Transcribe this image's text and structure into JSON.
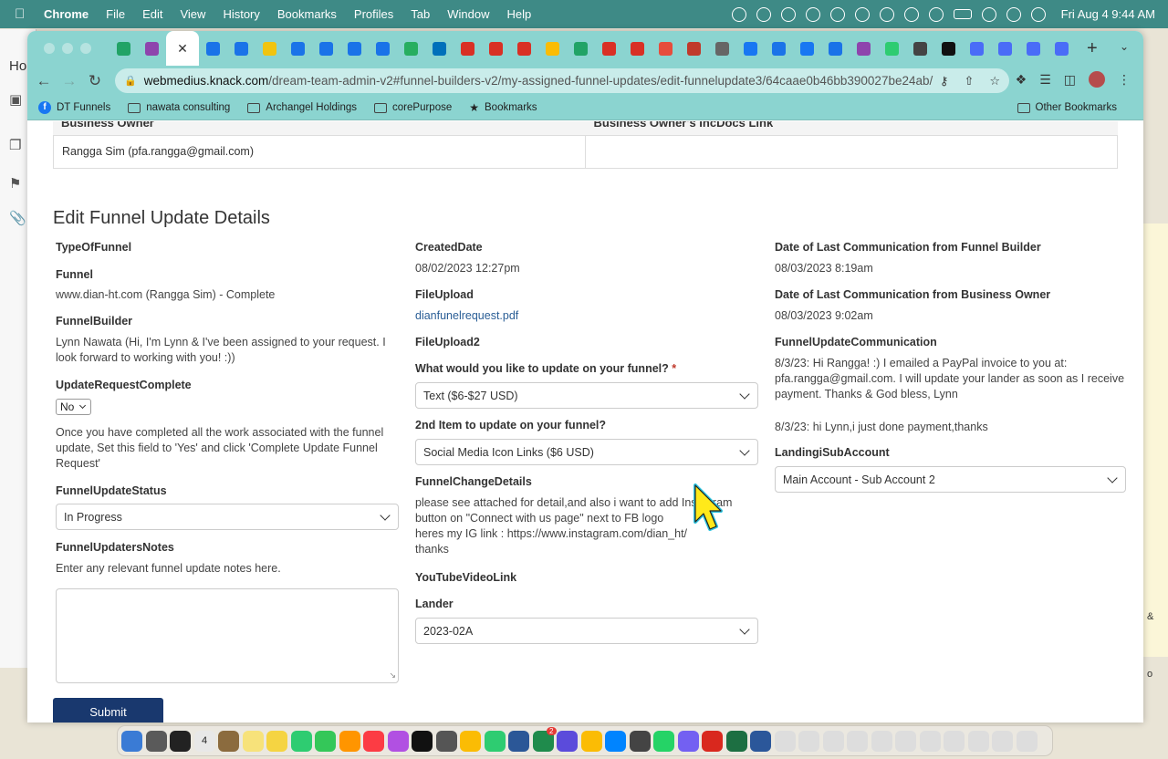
{
  "menubar": {
    "app_name": "Chrome",
    "items": [
      "File",
      "Edit",
      "View",
      "History",
      "Bookmarks",
      "Profiles",
      "Tab",
      "Window",
      "Help"
    ],
    "clock": "Fri Aug 4  9:44 AM"
  },
  "background": {
    "window_label": "Ho",
    "right_panel_texts": [
      "&",
      "o"
    ]
  },
  "browser": {
    "url_host": "webmedius.knack.com",
    "url_path": "/dream-team-admin-v2#funnel-builders-v2/my-assigned-funnel-updates/edit-funnelupdate3/64caae0b46bb390027be24ab/",
    "bookmarks": [
      "DT Funnels",
      "nawata consulting",
      "Archangel Holdings",
      "corePurpose",
      "Bookmarks"
    ],
    "other_bookmarks": "Other Bookmarks",
    "tab_favicon_colors": [
      "#21a366",
      "#8e44ad",
      "#1a73e8",
      "#1a73e8",
      "#f1c40f",
      "#1a73e8",
      "#1a73e8",
      "#1a73e8",
      "#1a73e8",
      "#27ae60",
      "#0070ba",
      "#d93025",
      "#d93025",
      "#d93025",
      "#fbbc04",
      "#21a366",
      "#d93025",
      "#d93025",
      "#e74c3c",
      "#c0392b",
      "#666666",
      "#1877f2",
      "#1a73e8",
      "#1877f2",
      "#1a73e8",
      "#8e44ad",
      "#2ecc71",
      "#444444",
      "#111111",
      "#4a6cf7",
      "#4a6cf7",
      "#4a6cf7",
      "#4a6cf7"
    ]
  },
  "owner_table": {
    "col1_header": "Business Owner",
    "col2_header": "Business Owner's IncDocs Link",
    "col1_value": "Rangga Sim (pfa.rangga@gmail.com)",
    "col2_value": ""
  },
  "form": {
    "title": "Edit Funnel Update Details",
    "col1": {
      "type_label": "TypeOfFunnel",
      "funnel_label": "Funnel",
      "funnel_value": "www.dian-ht.com (Rangga Sim) - Complete",
      "builder_label": "FunnelBuilder",
      "builder_value": "Lynn Nawata (Hi, I'm Lynn & I've been assigned to your request. I look forward to working with you! :))",
      "complete_label": "UpdateRequestComplete",
      "complete_value": "No",
      "complete_help": "Once you have completed all the work associated with the funnel update, Set this field to 'Yes' and click 'Complete Update Funnel Request'",
      "status_label": "FunnelUpdateStatus",
      "status_value": "In Progress",
      "notes_label": "FunnelUpdatersNotes",
      "notes_help": "Enter any relevant funnel update notes here."
    },
    "col2": {
      "created_label": "CreatedDate",
      "created_value": "08/02/2023 12:27pm",
      "fileupload_label": "FileUpload",
      "fileupload_value": "dianfunelrequest.pdf",
      "fileupload2_label": "FileUpload2",
      "update_label": "What would you like to update on your funnel?",
      "required_mark": "*",
      "update_value": "Text ($6-$27 USD)",
      "item2_label": "2nd Item to update on your funnel?",
      "item2_value": "Social Media Icon Links ($6 USD)",
      "details_label": "FunnelChangeDetails",
      "details_lines": [
        "please see attached for detail,and also i want to add Instagram",
        "button on \"Connect with us page\" next to FB logo",
        "heres my IG link : https://www.instagram.com/dian_ht/",
        "thanks"
      ],
      "youtube_label": "YouTubeVideoLink",
      "lander_label": "Lander",
      "lander_value": "2023-02A"
    },
    "col3": {
      "last_fb_label": "Date of Last Communication from Funnel Builder",
      "last_fb_value": "08/03/2023 8:19am",
      "last_bo_label": "Date of Last Communication from Business Owner",
      "last_bo_value": "08/03/2023 9:02am",
      "comm_label": "FunnelUpdateCommunication",
      "comm_value": "8/3/23: Hi Rangga! :) I emailed a PayPal invoice to you at: pfa.rangga@gmail.com. I will update your lander as soon as I receive payment. Thanks & God bless, Lynn",
      "comm_value2": "8/3/23: hi Lynn,i just done payment,thanks",
      "subaccount_label": "LandingiSubAccount",
      "subaccount_value": "Main Account - Sub Account 2"
    },
    "submit_label": "Submit"
  },
  "dock": {
    "calendar_day": "4",
    "badge": "2",
    "icon_colors": [
      "#3a7bd5",
      "#5a5a5a",
      "#222",
      "#e8e8e8",
      "#8b6b3e",
      "#f7e27a",
      "#f5d442",
      "#2ecc71",
      "#34c759",
      "#ff9500",
      "#fc3c44",
      "#b150e2",
      "#111",
      "#555",
      "#fbbc04",
      "#2ecc71",
      "#2b5797",
      "#1f8b4c",
      "#5b4bdb",
      "#fbbc04",
      "#0084ff",
      "#444",
      "#25d366",
      "#7360f2",
      "#d9281e",
      "#1d6f42",
      "#2b579a",
      "#ddd",
      "#ddd",
      "#ddd",
      "#ddd",
      "#ddd",
      "#ddd",
      "#ddd",
      "#ddd",
      "#ddd",
      "#ddd",
      "#ddd"
    ]
  }
}
